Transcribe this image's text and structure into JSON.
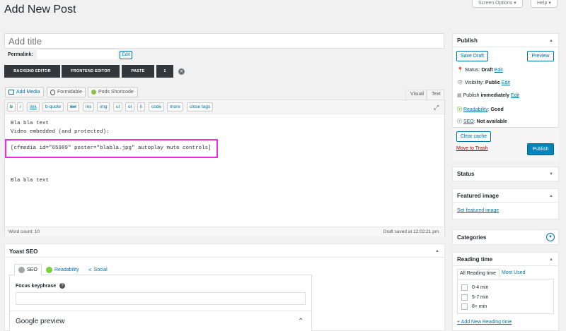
{
  "header": {
    "page_title": "Add New Post",
    "screen_options": "Screen Options ▾",
    "help": "Help ▾"
  },
  "title_field": {
    "placeholder": "Add title"
  },
  "permalink": {
    "label": "Permalink:",
    "edit": "Edit"
  },
  "builder_buttons": [
    "BACKEND EDITOR",
    "FRONTEND EDITOR",
    "PASTE",
    "1"
  ],
  "media_buttons": {
    "add_media": "Add Media",
    "formidable": "Formidable",
    "pods_shortcode": "Pods Shortcode"
  },
  "editor_tabs": {
    "visual": "Visual",
    "text": "Text"
  },
  "quicktags": [
    "b",
    "i",
    "link",
    "b-quote",
    "del",
    "ins",
    "img",
    "ul",
    "ol",
    "li",
    "code",
    "more",
    "close tags"
  ],
  "editor_content": {
    "line1": "Bla bla text",
    "line2": "Video embedded (and protected):",
    "shortcode": "[cfmedia id=\"65989\" poster=\"blabla.jpg\" autoplay mute controls]",
    "line4": "Bla bla text"
  },
  "status_bar": {
    "word_count": "Word count: 10",
    "draft_saved": "Draft saved at 12:02:21 pm."
  },
  "yoast": {
    "title": "Yoast SEO",
    "tabs": [
      "SEO",
      "Readability",
      "Social"
    ],
    "focus_label": "Focus keyphrase",
    "google_preview": "Google preview"
  },
  "publish": {
    "title": "Publish",
    "save_draft": "Save Draft",
    "preview": "Preview",
    "status_label": "Status:",
    "status_value": "Draft",
    "visibility_label": "Visibility:",
    "visibility_value": "Public",
    "publish_label": "Publish",
    "publish_value": "immediately",
    "edit": "Edit",
    "readability_label": "Readability",
    "readability_value": "Good",
    "seo_label": "SEO",
    "seo_value": "Not available",
    "clear_cache": "Clear cache",
    "move_to_trash": "Move to Trash",
    "publish_button": "Publish"
  },
  "status_panel": {
    "title": "Status"
  },
  "featured_image": {
    "title": "Featured image",
    "link": "Set featured image"
  },
  "categories": {
    "title": "Categories"
  },
  "reading_time": {
    "title": "Reading time",
    "tab_all": "All Reading time",
    "tab_most_used": "Most Used",
    "options": [
      "0-4 min",
      "5-7 min",
      "8+ min"
    ],
    "add_new": "+ Add New Reading time"
  },
  "colors": {
    "highlight": "#f02ae0",
    "primary": "#0085ba",
    "link": "#0073aa",
    "readability_good": "#7ad03a",
    "seo_grey": "#a0a5aa"
  }
}
